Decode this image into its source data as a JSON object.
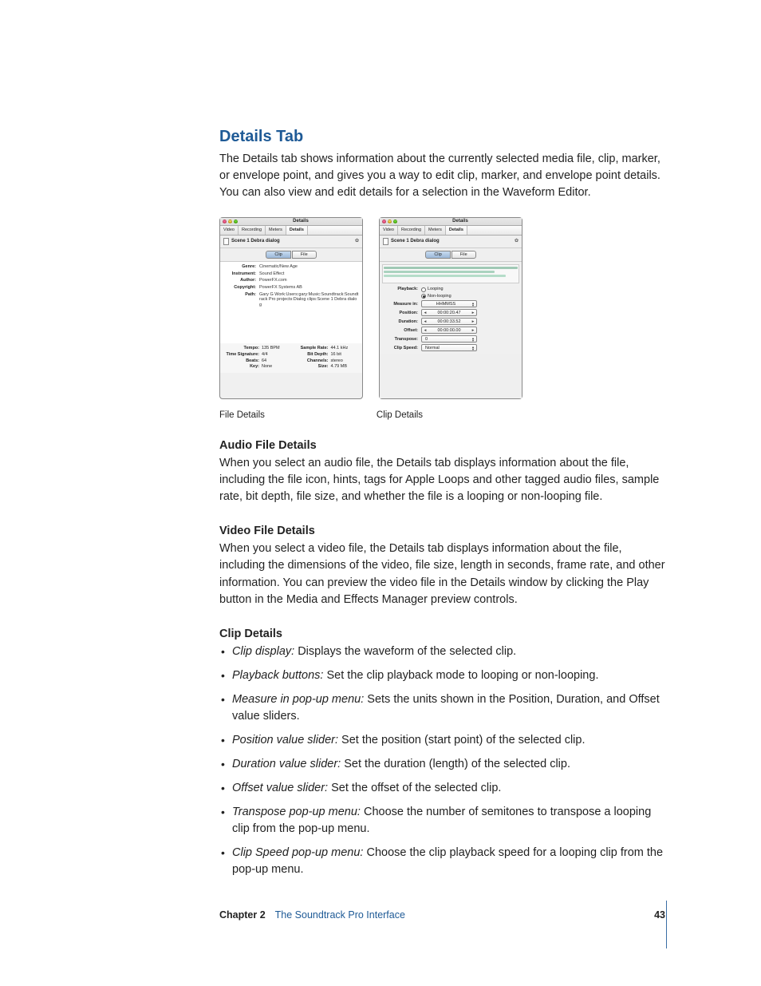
{
  "heading": "Details Tab",
  "intro": "The Details tab shows information about the currently selected media file, clip, marker, or envelope point, and gives you a way to edit clip, marker, and envelope point details. You can also view and edit details for a selection in the Waveform Editor.",
  "panel_title": "Details",
  "panel_tabs": [
    "Video",
    "Recording",
    "Meters",
    "Details"
  ],
  "clip_filename": "Scene 1 Debra dialog",
  "subtabs": {
    "clip": "Clip",
    "file": "File"
  },
  "file_panel": {
    "rows": {
      "genre_label": "Genre:",
      "genre_val": "Cinematic/New Age",
      "instrument_label": "Instrument:",
      "instrument_val": "Sound Effect",
      "author_label": "Author:",
      "author_val": "PowerFX.com",
      "copyright_label": "Copyright:",
      "copyright_val": "PowerFX Systems AB",
      "path_label": "Path:",
      "path_val": "Gary G Work:Users:gary:Music:Soundtrack:Soundtrack Pro projects:Dialog clips:Scene 1 Debra dialog"
    },
    "footer": {
      "tempo_label": "Tempo:",
      "tempo_val": "135 BPM",
      "sr_label": "Sample Rate:",
      "sr_val": "44.1 kHz",
      "ts_label": "Time Signature:",
      "ts_val": "4/4",
      "bd_label": "Bit Depth:",
      "bd_val": "16 bit",
      "beats_label": "Beats:",
      "beats_val": "64",
      "ch_label": "Channels:",
      "ch_val": "stereo",
      "key_label": "Key:",
      "key_val": "None",
      "size_label": "Size:",
      "size_val": "4.79 MB"
    }
  },
  "clip_panel": {
    "playback_label": "Playback:",
    "looping": "Looping",
    "nonlooping": "Non-looping",
    "measure_label": "Measure in:",
    "measure_val": "HHMMSS",
    "position_label": "Position:",
    "position_val": "00:00:20.47",
    "duration_label": "Duration:",
    "duration_val": "00:00:33.52",
    "offset_label": "Offset:",
    "offset_val": "00:00:00.00",
    "transpose_label": "Transpose:",
    "transpose_val": "0",
    "clipspeed_label": "Clip Speed:",
    "clipspeed_val": "Normal"
  },
  "captions": {
    "file": "File Details",
    "clip": "Clip Details"
  },
  "sections": {
    "audio_title": "Audio File Details",
    "audio_body": "When you select an audio file, the Details tab displays information about the file, including the file icon, hints, tags for Apple Loops and other tagged audio files, sample rate, bit depth, file size, and whether the file is a looping or non-looping file.",
    "video_title": "Video File Details",
    "video_body": "When you select a video file, the Details tab displays information about the file, including the dimensions of the video, file size, length in seconds, frame rate, and other information. You can preview the video file in the Details window by clicking the Play button in the Media and Effects Manager preview controls.",
    "clip_title": "Clip Details"
  },
  "clip_bullets": [
    {
      "term": "Clip display:",
      "text": "  Displays the waveform of the selected clip."
    },
    {
      "term": "Playback buttons:",
      "text": "  Set the clip playback mode to looping or non-looping."
    },
    {
      "term": "Measure in pop-up menu:",
      "text": "  Sets the units shown in the Position, Duration, and Offset value sliders."
    },
    {
      "term": "Position value slider:",
      "text": "  Set the position (start point) of the selected clip."
    },
    {
      "term": "Duration value slider:",
      "text": "  Set the duration (length) of the selected clip."
    },
    {
      "term": "Offset value slider:",
      "text": "  Set the offset of the selected clip."
    },
    {
      "term": "Transpose pop-up menu:",
      "text": "  Choose the number of semitones to transpose a looping clip from the pop-up menu."
    },
    {
      "term": "Clip Speed pop-up menu:",
      "text": "  Choose the clip playback speed for a looping clip from the pop-up menu."
    }
  ],
  "footer": {
    "chapter_label": "Chapter 2",
    "chapter_title": "The Soundtrack Pro Interface",
    "page": "43"
  }
}
